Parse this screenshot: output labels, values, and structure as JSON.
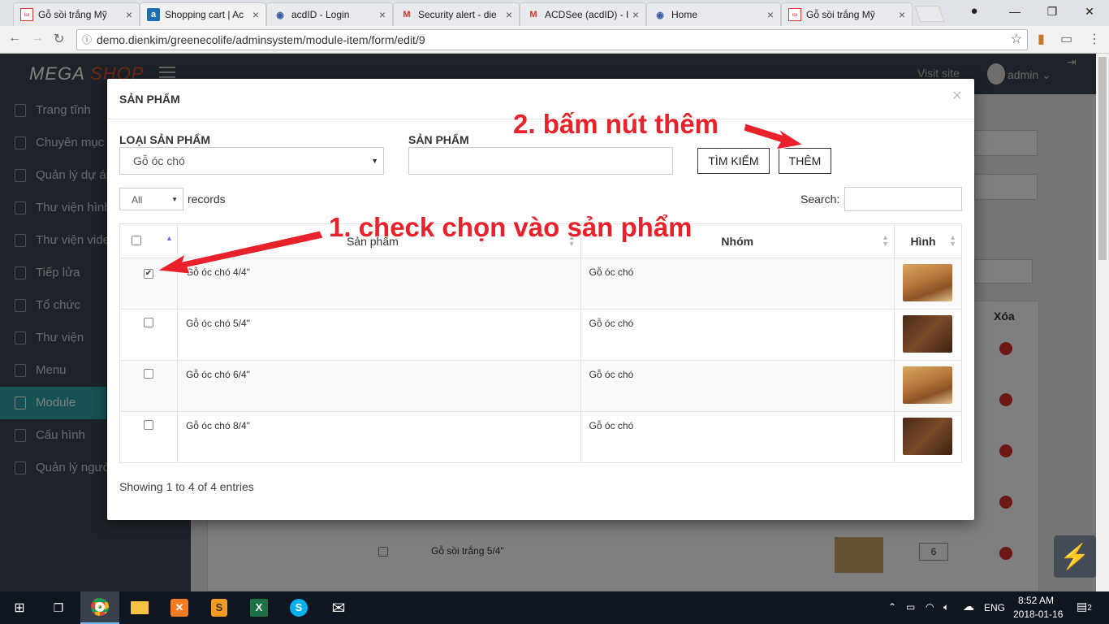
{
  "browser": {
    "tabs": [
      {
        "label": "Gỗ sồi trắng Mỹ",
        "active": false
      },
      {
        "label": "Shopping cart | Ac",
        "active": true
      },
      {
        "label": "acdID - Login",
        "active": false
      },
      {
        "label": "Security alert - die",
        "active": false
      },
      {
        "label": "ACDSee (acdID) - I",
        "active": false
      },
      {
        "label": "Home",
        "active": false
      },
      {
        "label": "Gỗ sồi trắng Mỹ",
        "active": false
      }
    ],
    "url": "demo.dienkim/greenecolife/adminsystem/module-item/form/edit/9"
  },
  "app": {
    "logo_part1": "MEGA",
    "logo_part2": "SHOP",
    "visit_site": "Visit site",
    "user": "admin",
    "sidebar": [
      {
        "label": "Trang tĩnh"
      },
      {
        "label": "Chuyên mục b"
      },
      {
        "label": "Quản lý dự án"
      },
      {
        "label": "Thư viện hình"
      },
      {
        "label": "Thư viện video"
      },
      {
        "label": "Tiếp lửa"
      },
      {
        "label": "Tổ chức"
      },
      {
        "label": "Thư viện"
      },
      {
        "label": "Menu"
      },
      {
        "label": "Module"
      },
      {
        "label": "Cấu hình"
      },
      {
        "label": "Quản lý người"
      }
    ],
    "background_table": {
      "col_delete": "Xóa",
      "row_name": "Gỗ sồi trắng 5/4\"",
      "row_order": "6"
    }
  },
  "modal": {
    "title": "SẢN PHẨM",
    "category_label": "LOẠI SẢN PHẨM",
    "category_value": "Gỗ óc chó",
    "product_label": "SẢN PHẨM",
    "product_value": "",
    "search_button": "TÌM KIẾM",
    "add_button": "THÊM",
    "length_value": "All",
    "length_suffix": "records",
    "search_label": "Search:",
    "columns": {
      "product": "Sản phẩm",
      "group": "Nhóm",
      "image": "Hình"
    },
    "rows": [
      {
        "checked": true,
        "name": "Gỗ óc chó 4/4\"",
        "group": "Gỗ óc chó"
      },
      {
        "checked": false,
        "name": "Gỗ óc chó 5/4\"",
        "group": "Gỗ óc chó"
      },
      {
        "checked": false,
        "name": "Gỗ óc chó 6/4\"",
        "group": "Gỗ óc chó"
      },
      {
        "checked": false,
        "name": "Gỗ óc chó 8/4\"",
        "group": "Gỗ óc chó"
      }
    ],
    "info": "Showing 1 to 4 of 4 entries"
  },
  "annotations": {
    "step1": "1. check chọn vào sản phẩm",
    "step2": "2. bấm nút thêm"
  },
  "taskbar": {
    "language": "ENG",
    "time": "8:52 AM",
    "date": "2018-01-16",
    "notifications": "2"
  },
  "colors": {
    "accent": "#2fa4a9",
    "sidebar": "#3b4752",
    "annotation": "#e8212b",
    "logo_shop": "#e8501f"
  }
}
